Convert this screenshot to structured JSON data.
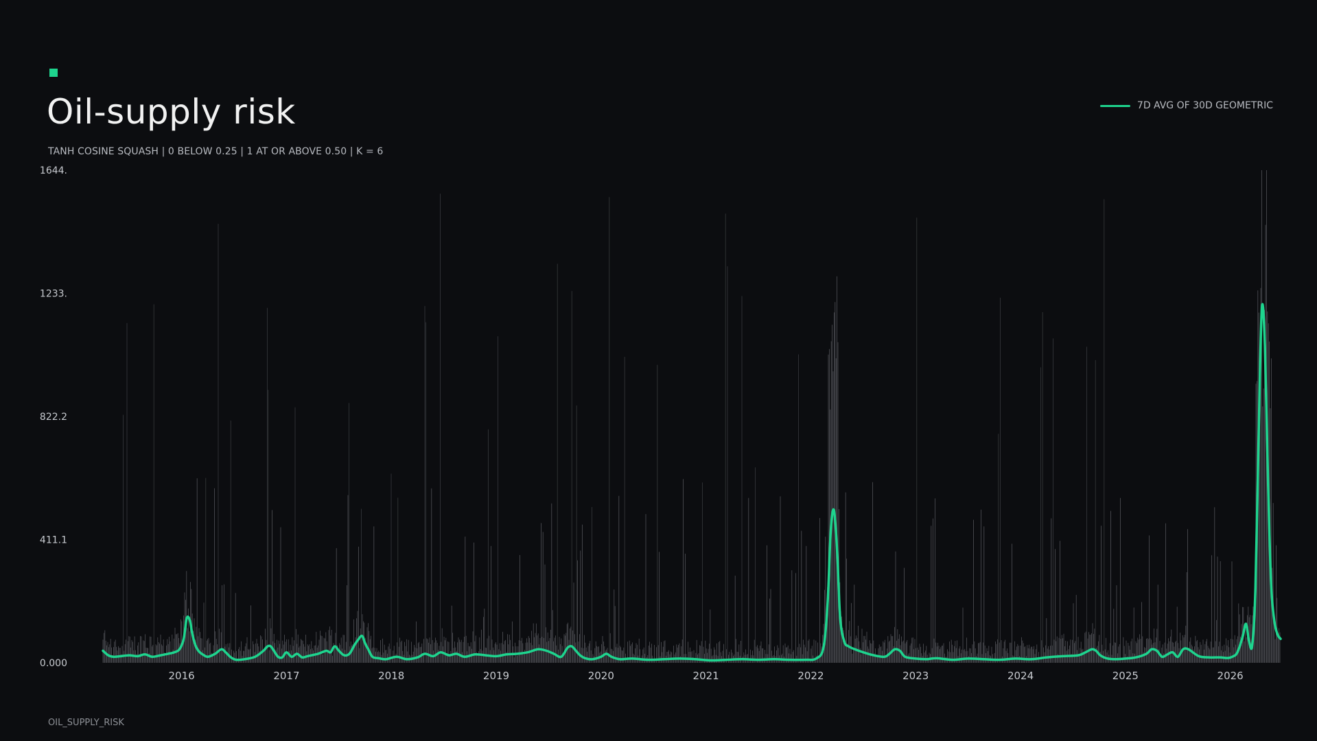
{
  "header": {
    "title": "Oil-supply risk",
    "subtitle": "TANH COSINE SQUASH | 0 BELOW 0.25 | 1 AT OR ABOVE 0.50 | K = 6"
  },
  "footer": {
    "label": "OIL_SUPPLY_RISK"
  },
  "colors": {
    "background": "#0c0d10",
    "accent": "#1ed48e",
    "raw_bars": "#8a8d93"
  },
  "chart_data": {
    "type": "line",
    "legend": {
      "placement": "top-right",
      "entries": [
        "7D AVG OF 30D GEOMETRIC"
      ]
    },
    "grid": false,
    "ylim": [
      0,
      1644
    ],
    "yticks": [
      "0.000",
      "411.1",
      "822.2",
      "1233.",
      "1644."
    ],
    "ytick_values": [
      0,
      411.1,
      822.2,
      1233,
      1644
    ],
    "xlim": [
      2015.25,
      2026.48
    ],
    "xticks": [
      "2016",
      "2017",
      "2018",
      "2019",
      "2020",
      "2021",
      "2022",
      "2023",
      "2024",
      "2025",
      "2026"
    ],
    "xtick_values": [
      2016,
      2017,
      2018,
      2019,
      2020,
      2021,
      2022,
      2023,
      2024,
      2025,
      2026
    ],
    "series": [
      {
        "name": "7D AVG OF 30D GEOMETRIC",
        "x": [
          2015.25,
          2015.3,
          2015.35,
          2015.42,
          2015.5,
          2015.58,
          2015.65,
          2015.72,
          2015.8,
          2015.87,
          2015.93,
          2015.98,
          2016.02,
          2016.05,
          2016.08,
          2016.1,
          2016.13,
          2016.16,
          2016.2,
          2016.25,
          2016.32,
          2016.38,
          2016.42,
          2016.47,
          2016.52,
          2016.6,
          2016.7,
          2016.78,
          2016.82,
          2016.85,
          2016.88,
          2016.92,
          2016.96,
          2017.0,
          2017.05,
          2017.1,
          2017.15,
          2017.2,
          2017.3,
          2017.38,
          2017.42,
          2017.46,
          2017.5,
          2017.55,
          2017.6,
          2017.65,
          2017.68,
          2017.72,
          2017.75,
          2017.78,
          2017.82,
          2017.88,
          2017.95,
          2018.05,
          2018.15,
          2018.25,
          2018.32,
          2018.4,
          2018.47,
          2018.55,
          2018.62,
          2018.7,
          2018.8,
          2018.9,
          2019.0,
          2019.1,
          2019.2,
          2019.3,
          2019.4,
          2019.48,
          2019.55,
          2019.62,
          2019.68,
          2019.72,
          2019.76,
          2019.8,
          2019.85,
          2019.92,
          2020.0,
          2020.05,
          2020.1,
          2020.18,
          2020.3,
          2020.45,
          2020.6,
          2020.75,
          2020.9,
          2021.05,
          2021.2,
          2021.35,
          2021.5,
          2021.65,
          2021.8,
          2021.95,
          2022.05,
          2022.12,
          2022.16,
          2022.19,
          2022.22,
          2022.25,
          2022.28,
          2022.32,
          2022.36,
          2022.42,
          2022.5,
          2022.6,
          2022.7,
          2022.75,
          2022.8,
          2022.85,
          2022.9,
          2023.0,
          2023.1,
          2023.2,
          2023.35,
          2023.5,
          2023.65,
          2023.8,
          2023.95,
          2024.1,
          2024.25,
          2024.4,
          2024.55,
          2024.62,
          2024.68,
          2024.72,
          2024.76,
          2024.82,
          2024.9,
          2025.0,
          2025.1,
          2025.2,
          2025.25,
          2025.3,
          2025.35,
          2025.4,
          2025.45,
          2025.5,
          2025.55,
          2025.6,
          2025.7,
          2025.8,
          2025.9,
          2025.98,
          2026.03,
          2026.06,
          2026.09,
          2026.12,
          2026.15,
          2026.18,
          2026.21,
          2026.24,
          2026.27,
          2026.3,
          2026.33,
          2026.36,
          2026.39,
          2026.42,
          2026.45,
          2026.48
        ],
        "values": [
          40,
          25,
          20,
          22,
          25,
          22,
          28,
          20,
          25,
          30,
          35,
          45,
          80,
          150,
          140,
          100,
          60,
          40,
          28,
          20,
          30,
          45,
          35,
          18,
          10,
          12,
          20,
          40,
          55,
          55,
          40,
          20,
          18,
          35,
          20,
          30,
          18,
          22,
          30,
          40,
          35,
          55,
          40,
          25,
          30,
          60,
          75,
          90,
          65,
          45,
          20,
          15,
          12,
          20,
          12,
          18,
          30,
          22,
          35,
          25,
          30,
          20,
          28,
          25,
          22,
          28,
          30,
          35,
          45,
          40,
          30,
          20,
          50,
          55,
          40,
          25,
          15,
          12,
          20,
          30,
          20,
          12,
          14,
          10,
          12,
          14,
          12,
          8,
          10,
          12,
          10,
          12,
          10,
          10,
          14,
          50,
          200,
          440,
          510,
          380,
          150,
          70,
          55,
          45,
          35,
          25,
          20,
          30,
          45,
          40,
          20,
          14,
          12,
          15,
          10,
          14,
          12,
          10,
          14,
          12,
          18,
          22,
          25,
          35,
          45,
          40,
          25,
          15,
          12,
          14,
          18,
          30,
          45,
          40,
          20,
          28,
          35,
          20,
          45,
          45,
          22,
          18,
          18,
          16,
          22,
          30,
          55,
          90,
          130,
          70,
          60,
          250,
          750,
          1180,
          1060,
          600,
          260,
          140,
          95,
          80
        ]
      }
    ]
  }
}
